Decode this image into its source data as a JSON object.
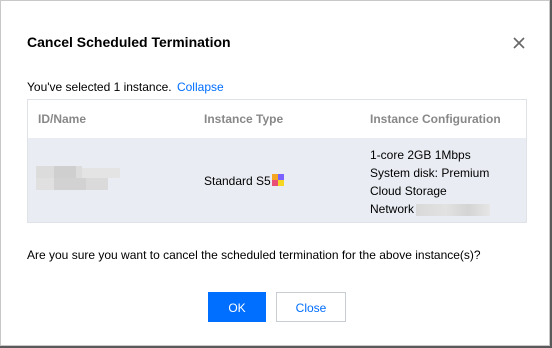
{
  "dialog": {
    "title": "Cancel Scheduled Termination",
    "close_icon": "close-icon"
  },
  "selection": {
    "text": "You've selected 1 instance.",
    "collapse_label": "Collapse"
  },
  "table": {
    "columns": [
      "ID/Name",
      "Instance Type",
      "Instance Configuration"
    ],
    "rows": [
      {
        "id_name": "",
        "instance_type": "Standard S5",
        "instance_type_icon": "instance-type-badge-icon",
        "config": [
          "1-core 2GB 1Mbps",
          "System disk: Premium",
          "Cloud Storage",
          "Network"
        ]
      }
    ]
  },
  "confirm_text": "Are you sure you want to cancel the scheduled termination for the above instance(s)?",
  "buttons": {
    "ok_label": "OK",
    "close_label": "Close"
  },
  "colors": {
    "primary": "#006eff",
    "row_bg": "#e9edf3",
    "header_text": "#888888"
  }
}
